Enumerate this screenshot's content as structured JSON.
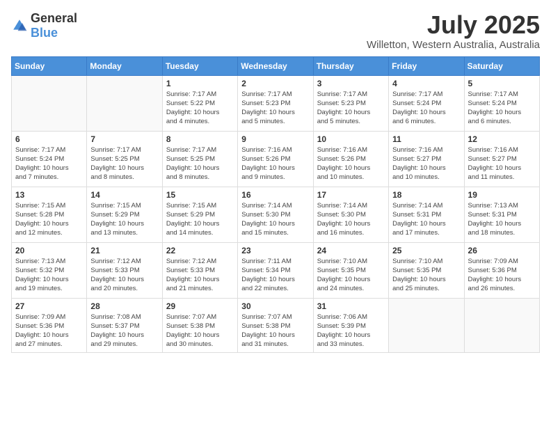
{
  "logo": {
    "general": "General",
    "blue": "Blue"
  },
  "title": "July 2025",
  "subtitle": "Willetton, Western Australia, Australia",
  "days_of_week": [
    "Sunday",
    "Monday",
    "Tuesday",
    "Wednesday",
    "Thursday",
    "Friday",
    "Saturday"
  ],
  "weeks": [
    [
      {
        "day": "",
        "info": ""
      },
      {
        "day": "",
        "info": ""
      },
      {
        "day": "1",
        "info": "Sunrise: 7:17 AM\nSunset: 5:22 PM\nDaylight: 10 hours\nand 4 minutes."
      },
      {
        "day": "2",
        "info": "Sunrise: 7:17 AM\nSunset: 5:23 PM\nDaylight: 10 hours\nand 5 minutes."
      },
      {
        "day": "3",
        "info": "Sunrise: 7:17 AM\nSunset: 5:23 PM\nDaylight: 10 hours\nand 5 minutes."
      },
      {
        "day": "4",
        "info": "Sunrise: 7:17 AM\nSunset: 5:24 PM\nDaylight: 10 hours\nand 6 minutes."
      },
      {
        "day": "5",
        "info": "Sunrise: 7:17 AM\nSunset: 5:24 PM\nDaylight: 10 hours\nand 6 minutes."
      }
    ],
    [
      {
        "day": "6",
        "info": "Sunrise: 7:17 AM\nSunset: 5:24 PM\nDaylight: 10 hours\nand 7 minutes."
      },
      {
        "day": "7",
        "info": "Sunrise: 7:17 AM\nSunset: 5:25 PM\nDaylight: 10 hours\nand 8 minutes."
      },
      {
        "day": "8",
        "info": "Sunrise: 7:17 AM\nSunset: 5:25 PM\nDaylight: 10 hours\nand 8 minutes."
      },
      {
        "day": "9",
        "info": "Sunrise: 7:16 AM\nSunset: 5:26 PM\nDaylight: 10 hours\nand 9 minutes."
      },
      {
        "day": "10",
        "info": "Sunrise: 7:16 AM\nSunset: 5:26 PM\nDaylight: 10 hours\nand 10 minutes."
      },
      {
        "day": "11",
        "info": "Sunrise: 7:16 AM\nSunset: 5:27 PM\nDaylight: 10 hours\nand 10 minutes."
      },
      {
        "day": "12",
        "info": "Sunrise: 7:16 AM\nSunset: 5:27 PM\nDaylight: 10 hours\nand 11 minutes."
      }
    ],
    [
      {
        "day": "13",
        "info": "Sunrise: 7:15 AM\nSunset: 5:28 PM\nDaylight: 10 hours\nand 12 minutes."
      },
      {
        "day": "14",
        "info": "Sunrise: 7:15 AM\nSunset: 5:29 PM\nDaylight: 10 hours\nand 13 minutes."
      },
      {
        "day": "15",
        "info": "Sunrise: 7:15 AM\nSunset: 5:29 PM\nDaylight: 10 hours\nand 14 minutes."
      },
      {
        "day": "16",
        "info": "Sunrise: 7:14 AM\nSunset: 5:30 PM\nDaylight: 10 hours\nand 15 minutes."
      },
      {
        "day": "17",
        "info": "Sunrise: 7:14 AM\nSunset: 5:30 PM\nDaylight: 10 hours\nand 16 minutes."
      },
      {
        "day": "18",
        "info": "Sunrise: 7:14 AM\nSunset: 5:31 PM\nDaylight: 10 hours\nand 17 minutes."
      },
      {
        "day": "19",
        "info": "Sunrise: 7:13 AM\nSunset: 5:31 PM\nDaylight: 10 hours\nand 18 minutes."
      }
    ],
    [
      {
        "day": "20",
        "info": "Sunrise: 7:13 AM\nSunset: 5:32 PM\nDaylight: 10 hours\nand 19 minutes."
      },
      {
        "day": "21",
        "info": "Sunrise: 7:12 AM\nSunset: 5:33 PM\nDaylight: 10 hours\nand 20 minutes."
      },
      {
        "day": "22",
        "info": "Sunrise: 7:12 AM\nSunset: 5:33 PM\nDaylight: 10 hours\nand 21 minutes."
      },
      {
        "day": "23",
        "info": "Sunrise: 7:11 AM\nSunset: 5:34 PM\nDaylight: 10 hours\nand 22 minutes."
      },
      {
        "day": "24",
        "info": "Sunrise: 7:10 AM\nSunset: 5:35 PM\nDaylight: 10 hours\nand 24 minutes."
      },
      {
        "day": "25",
        "info": "Sunrise: 7:10 AM\nSunset: 5:35 PM\nDaylight: 10 hours\nand 25 minutes."
      },
      {
        "day": "26",
        "info": "Sunrise: 7:09 AM\nSunset: 5:36 PM\nDaylight: 10 hours\nand 26 minutes."
      }
    ],
    [
      {
        "day": "27",
        "info": "Sunrise: 7:09 AM\nSunset: 5:36 PM\nDaylight: 10 hours\nand 27 minutes."
      },
      {
        "day": "28",
        "info": "Sunrise: 7:08 AM\nSunset: 5:37 PM\nDaylight: 10 hours\nand 29 minutes."
      },
      {
        "day": "29",
        "info": "Sunrise: 7:07 AM\nSunset: 5:38 PM\nDaylight: 10 hours\nand 30 minutes."
      },
      {
        "day": "30",
        "info": "Sunrise: 7:07 AM\nSunset: 5:38 PM\nDaylight: 10 hours\nand 31 minutes."
      },
      {
        "day": "31",
        "info": "Sunrise: 7:06 AM\nSunset: 5:39 PM\nDaylight: 10 hours\nand 33 minutes."
      },
      {
        "day": "",
        "info": ""
      },
      {
        "day": "",
        "info": ""
      }
    ]
  ]
}
